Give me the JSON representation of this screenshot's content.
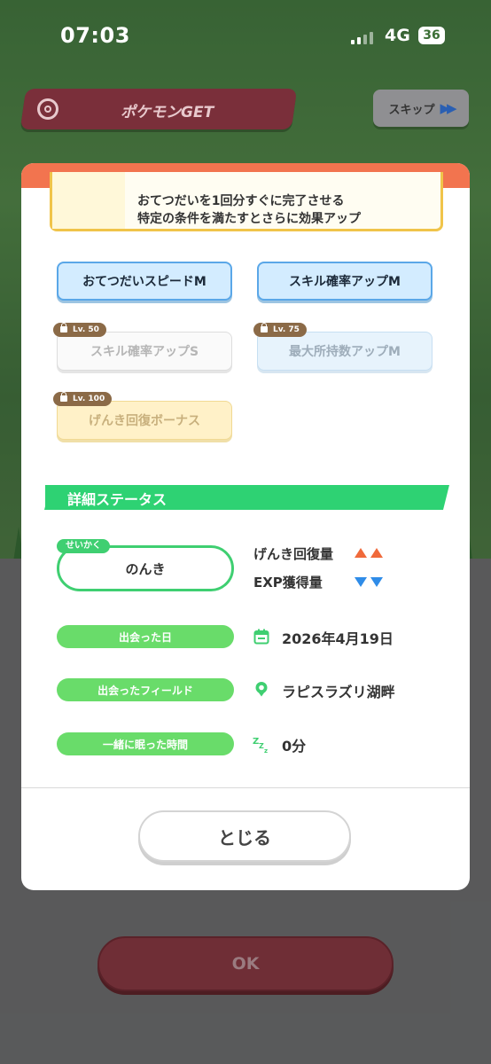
{
  "status_bar": {
    "time": "07:03",
    "network": "4G",
    "battery": "36"
  },
  "header": {
    "title": "ポケモンGET",
    "skip_label": "スキップ"
  },
  "effect_box": {
    "line1": "おてつだいを1回分すぐに完了させる",
    "line2": "特定の条件を満たすとさらに効果アップ"
  },
  "skills": [
    {
      "label": "おてつだいスピードM",
      "locked": false,
      "badge": ""
    },
    {
      "label": "スキル確率アップM",
      "locked": false,
      "badge": ""
    },
    {
      "label": "スキル確率アップS",
      "locked": true,
      "badge": "Lv. 50"
    },
    {
      "label": "最大所持数アップM",
      "locked": true,
      "badge": "Lv. 75"
    },
    {
      "label": "げんき回復ボーナス",
      "locked": true,
      "badge": "Lv. 100"
    }
  ],
  "details": {
    "section_title": "詳細ステータス",
    "nature_label": "せいかく",
    "nature_value": "のんき",
    "stat_up": "げんき回復量",
    "stat_down": "EXP獲得量",
    "met_date_label": "出会った日",
    "met_date_value": "2026年4月19日",
    "met_field_label": "出会ったフィールド",
    "met_field_value": "ラピスラズリ湖畔",
    "sleep_time_label": "一緒に眠った時間",
    "sleep_time_value": "0分"
  },
  "buttons": {
    "close_label": "とじる",
    "ok_label": "OK"
  },
  "colors": {
    "accent_green": "#2ed273",
    "pill_green": "#69dc6a",
    "header_orange": "#f2744f",
    "up_arrow": "#f06a3b",
    "down_arrow": "#2f8ce8"
  },
  "icons": {
    "skip": "fast-forward-icon",
    "title": "pokeball-icon",
    "date": "calendar-icon",
    "field": "map-pin-icon",
    "sleep": "zzz-icon"
  }
}
